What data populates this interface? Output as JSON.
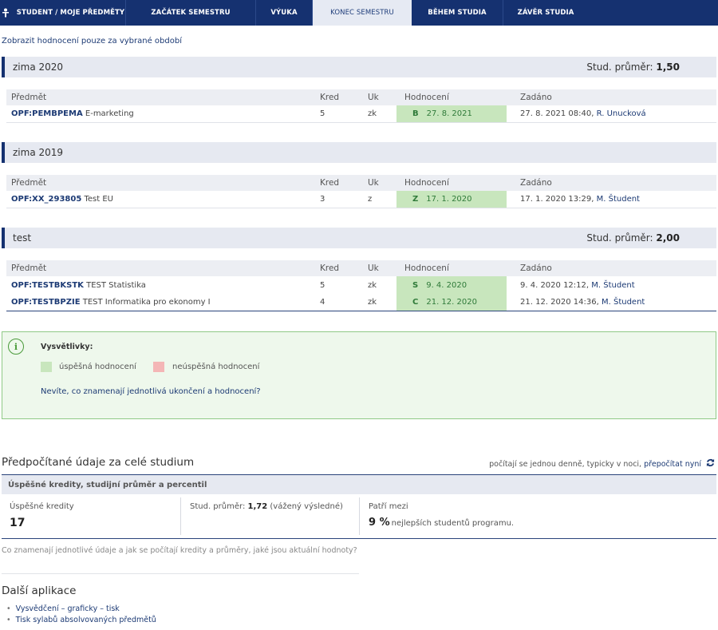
{
  "nav": {
    "items": [
      {
        "label": "STUDENT / MOJE PŘEDMĚTY"
      },
      {
        "label": "ZAČÁTEK SEMESTRU"
      },
      {
        "label": "VÝUKA"
      },
      {
        "label": "KONEC SEMESTRU"
      },
      {
        "label": "BĚHEM STUDIA"
      },
      {
        "label": "ZÁVĚR STUDIA"
      }
    ],
    "active": "KONEC SEMESTRU"
  },
  "filter_link": "Zobrazit hodnocení pouze za vybrané období",
  "table_headers": {
    "subject": "Předmět",
    "kred": "Kred",
    "uk": "Uk",
    "grade": "Hodnocení",
    "assigned": "Zadáno"
  },
  "semesters": [
    {
      "title": "zima 2020",
      "avg_label": "Stud. průměr:",
      "avg_value": "1,50",
      "rows": [
        {
          "code": "OPF:PEMBPEMA",
          "name": "E-marketing",
          "kred": "5",
          "uk": "zk",
          "grade": "B",
          "date": "27. 8. 2021",
          "assigned": "27. 8. 2021 08:40,",
          "person": "R. Unucková"
        }
      ]
    },
    {
      "title": "zima 2019",
      "rows": [
        {
          "code": "OPF:XX_293805",
          "name": "Test EU",
          "kred": "3",
          "uk": "z",
          "grade": "Z",
          "date": "17. 1. 2020",
          "assigned": "17. 1. 2020 13:29,",
          "person": "M. Študent"
        }
      ]
    },
    {
      "title": "test",
      "avg_label": "Stud. průměr:",
      "avg_value": "2,00",
      "rows": [
        {
          "code": "OPF:TESTBKSTK",
          "name": "TEST Statistika",
          "kred": "5",
          "uk": "zk",
          "grade": "S",
          "date": "9. 4. 2020",
          "assigned": "9. 4. 2020 12:12,",
          "person": "M. Študent"
        },
        {
          "code": "OPF:TESTBPZIE",
          "name": "TEST Informatika pro ekonomy I",
          "kred": "4",
          "uk": "zk",
          "grade": "C",
          "date": "21. 12. 2020",
          "assigned": "21. 12. 2020 14:36,",
          "person": "M. Študent"
        }
      ]
    }
  ],
  "legend": {
    "title": "Vysvětlivky:",
    "success": "úspěšná hodnocení",
    "fail": "neúspěšná hodnocení",
    "link": "Nevíte, co znamenají jednotlivá ukončení a hodnocení?",
    "colors": {
      "success": "#c8e6bd",
      "fail": "#f4b6b6"
    }
  },
  "precomputed": {
    "title": "Předpočítané údaje za celé studium",
    "note_prefix": "počítají se jednou denně, typicky v noci,",
    "recalc_link": "přepočítat nyní",
    "subhead": "Úspěšné kredity, studijní průměr a percentil",
    "credits_label": "Úspěšné kredity",
    "credits_value": "17",
    "avg_prefix": "Stud. průměr:",
    "avg_value": "1,72",
    "avg_suffix": "(vážený výsledné)",
    "percentile_label": "Patří mezi",
    "percentile_value": "9 %",
    "percentile_suffix": "nejlepších studentů programu.",
    "footnote": "Co znamenají jednotlivé údaje a jak se počítají kredity a průměry, jaké jsou aktuální hodnoty?"
  },
  "apps": {
    "title": "Další aplikace",
    "items": [
      "Vysvědčení – graficky – tisk",
      "Tisk sylabů absolvovaných předmětů"
    ]
  }
}
